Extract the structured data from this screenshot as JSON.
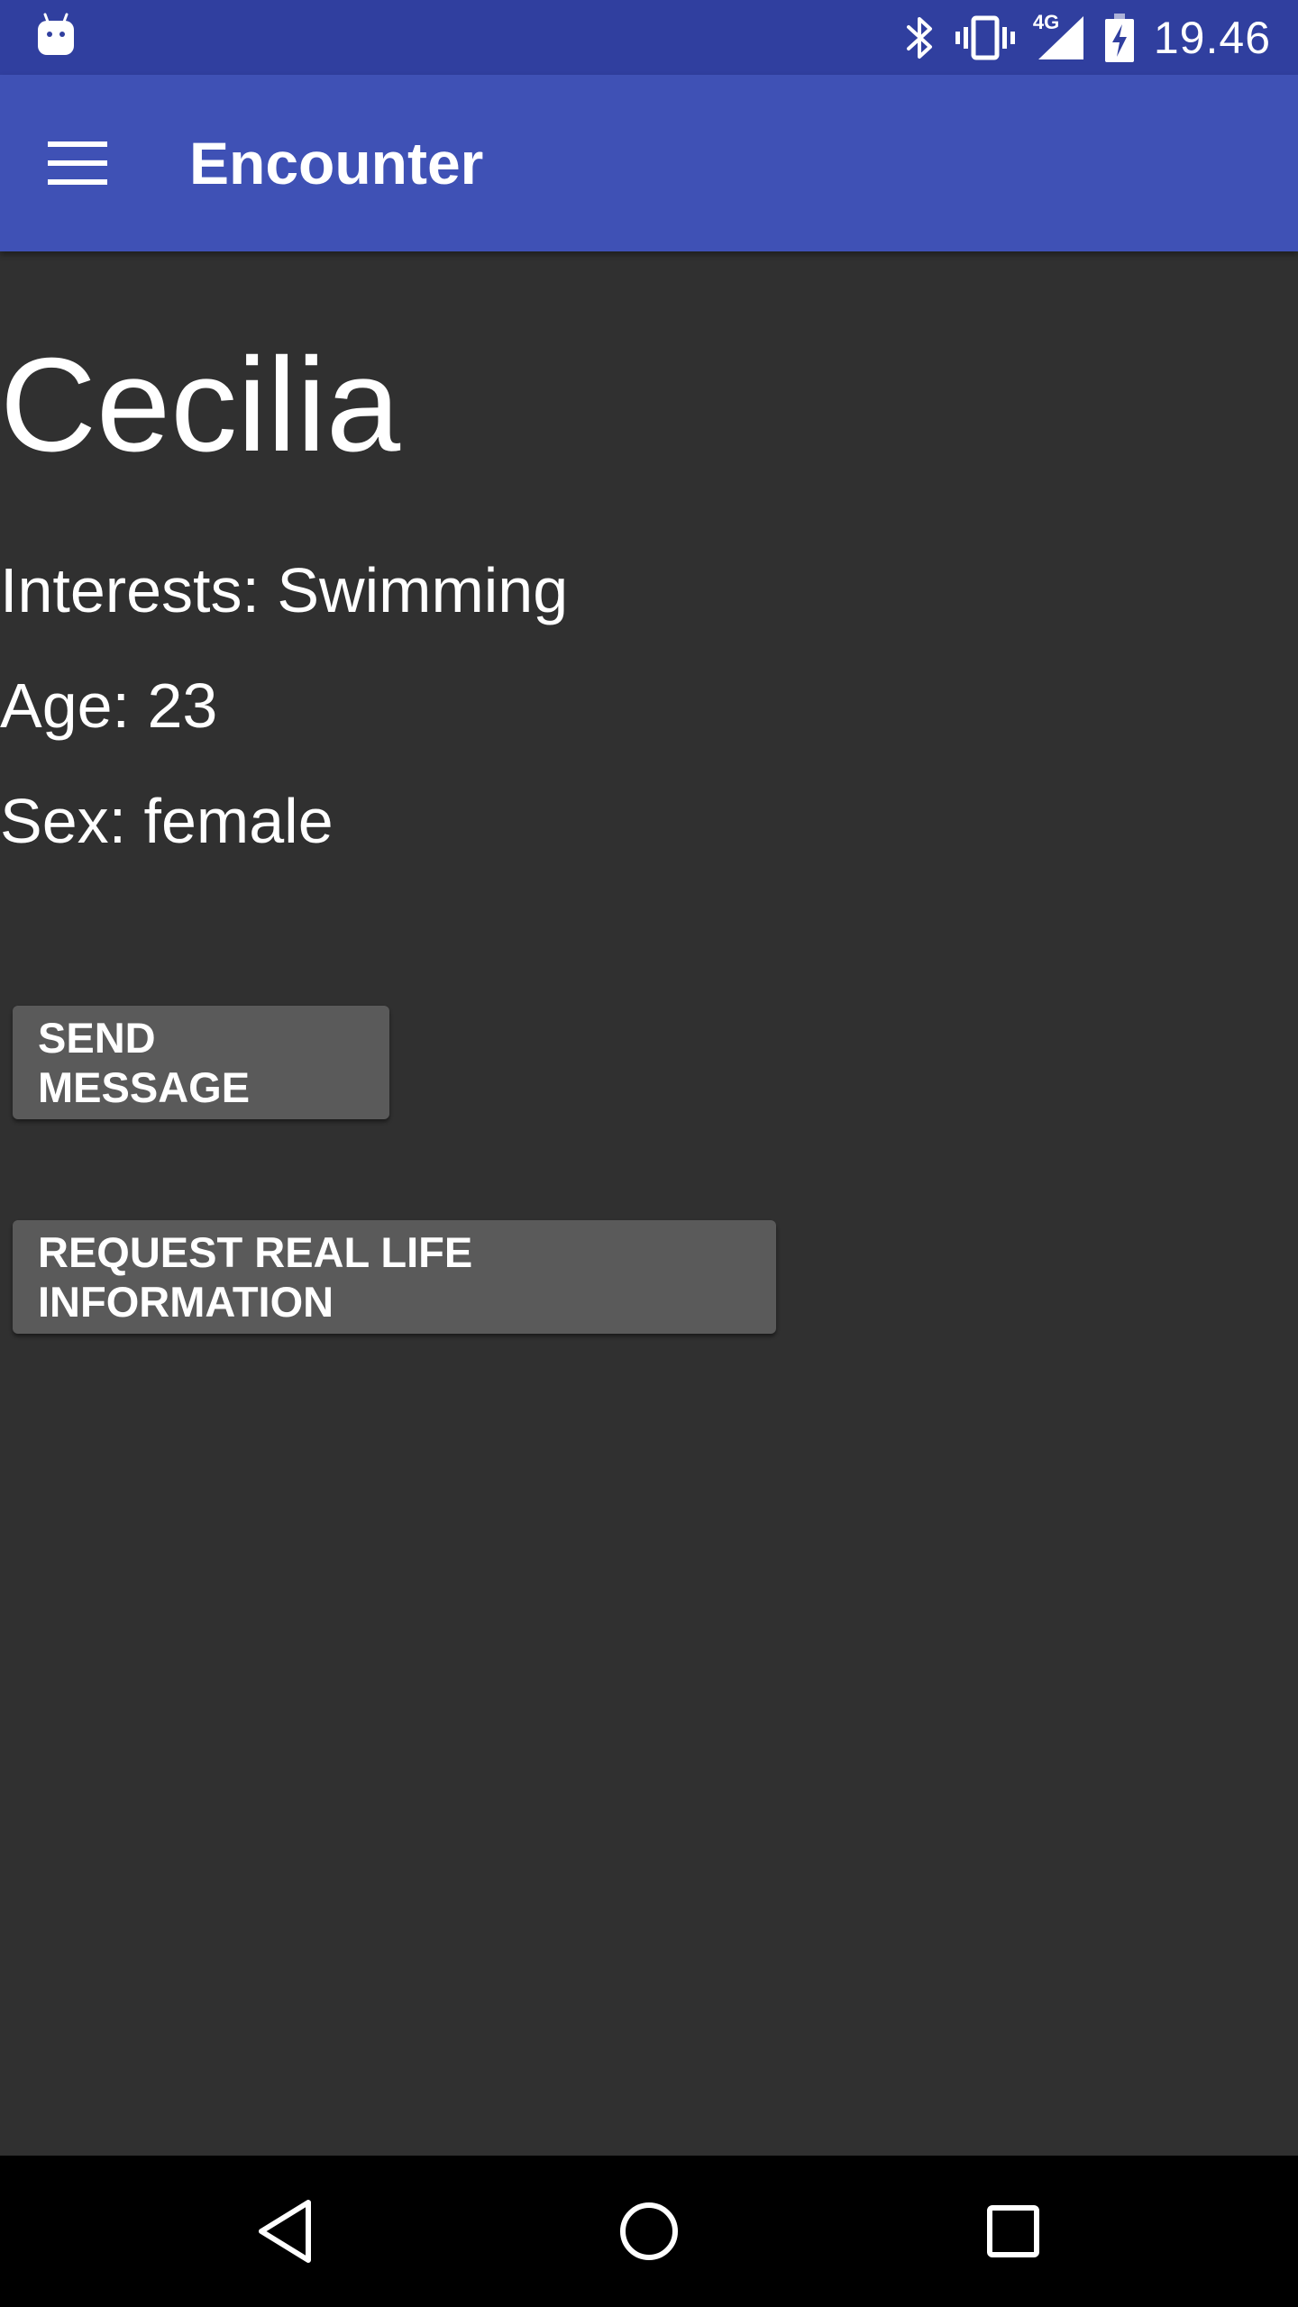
{
  "status_bar": {
    "time": "19.46",
    "network_label": "4G",
    "icons": [
      "android-notification-icon",
      "bluetooth-icon",
      "vibrate-icon",
      "signal-icon",
      "battery-charging-icon"
    ]
  },
  "app_bar": {
    "title": "Encounter",
    "menu_icon": "hamburger-menu-icon"
  },
  "profile": {
    "name": "Cecilia",
    "interests": "Interests: Swimming",
    "age": "Age: 23",
    "sex": "Sex: female"
  },
  "actions": {
    "send_message": "SEND MESSAGE",
    "request_info": "REQUEST REAL LIFE INFORMATION"
  },
  "nav_bar": {
    "icons": [
      "back-icon",
      "home-icon",
      "recents-icon"
    ]
  },
  "colors": {
    "status_bar": "#303f9f",
    "app_bar": "#3f51b5",
    "background": "#303030",
    "button": "#5a5a5a",
    "nav_bar": "#000000"
  }
}
